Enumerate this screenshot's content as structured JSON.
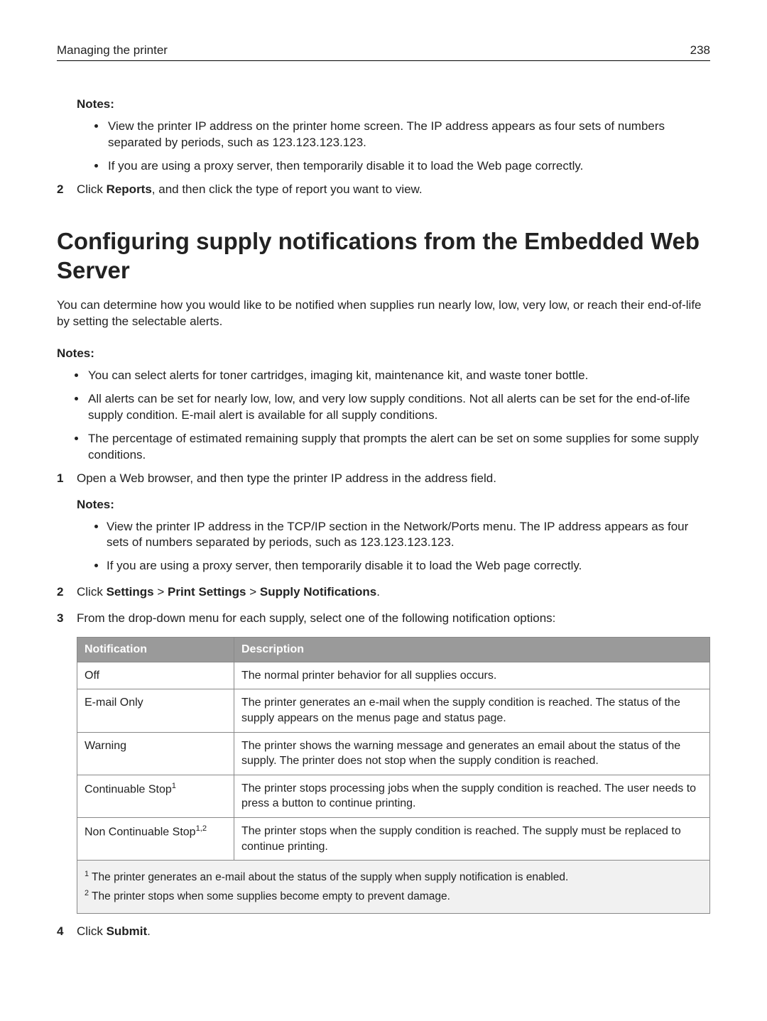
{
  "header": {
    "title": "Managing the printer",
    "page": "238"
  },
  "top_notes_label": "Notes:",
  "top_notes": [
    "View the printer IP address on the printer home screen. The IP address appears as four sets of numbers separated by periods, such as 123.123.123.123.",
    "If you are using a proxy server, then temporarily disable it to load the Web page correctly."
  ],
  "step2_prefix": "Click ",
  "step2_bold": "Reports",
  "step2_suffix": ", and then click the type of report you want to view.",
  "h1": "Configuring supply notifications from the Embedded Web Server",
  "intro": "You can determine how you would like to be notified when supplies run nearly low, low, very low, or reach their end-of-life by setting the selectable alerts.",
  "notes2_label": "Notes:",
  "notes2": [
    "You can select alerts for toner cartridges, imaging kit, maintenance kit, and waste toner bottle.",
    "All alerts can be set for nearly low, low, and very low supply conditions. Not all alerts can be set for the end-of-life supply condition. E-mail alert is available for all supply conditions.",
    "The percentage of estimated remaining supply that prompts the alert can be set on some supplies for some supply conditions."
  ],
  "steps": {
    "s1": "Open a Web browser, and then type the printer IP address in the address field.",
    "s1_notes_label": "Notes:",
    "s1_notes": [
      "View the printer IP address in the TCP/IP section in the Network/Ports menu. The IP address appears as four sets of numbers separated by periods, such as 123.123.123.123.",
      "If you are using a proxy server, then temporarily disable it to load the Web page correctly."
    ],
    "s2_prefix": "Click ",
    "s2_b1": "Settings",
    "s2_sep1": " > ",
    "s2_b2": "Print Settings",
    "s2_sep2": " > ",
    "s2_b3": "Supply Notifications",
    "s2_suffix": ".",
    "s3": "From the drop-down menu for each supply, select one of the following notification options:",
    "s4_prefix": "Click ",
    "s4_bold": "Submit",
    "s4_suffix": "."
  },
  "table": {
    "h1": "Notification",
    "h2": "Description",
    "rows": [
      {
        "n": "Off",
        "d": "The normal printer behavior for all supplies occurs."
      },
      {
        "n": "E-mail Only",
        "d": "The printer generates an e-mail when the supply condition is reached. The status of the supply appears on the menus page and status page."
      },
      {
        "n": "Warning",
        "d": "The printer shows the warning message and generates an email about the status of the supply. The printer does not stop when the supply condition is reached."
      },
      {
        "n": "Continuable Stop",
        "sup": "1",
        "d": "The printer stops processing jobs when the supply condition is reached. The user needs to press a button to continue printing."
      },
      {
        "n": "Non Continuable Stop",
        "sup": "1,2",
        "d": "The printer stops when the supply condition is reached. The supply must be replaced to continue printing."
      }
    ],
    "foot1": " The printer generates an e-mail about the status of the supply when supply notification is enabled.",
    "foot2": " The printer stops when some supplies become empty to prevent damage."
  }
}
